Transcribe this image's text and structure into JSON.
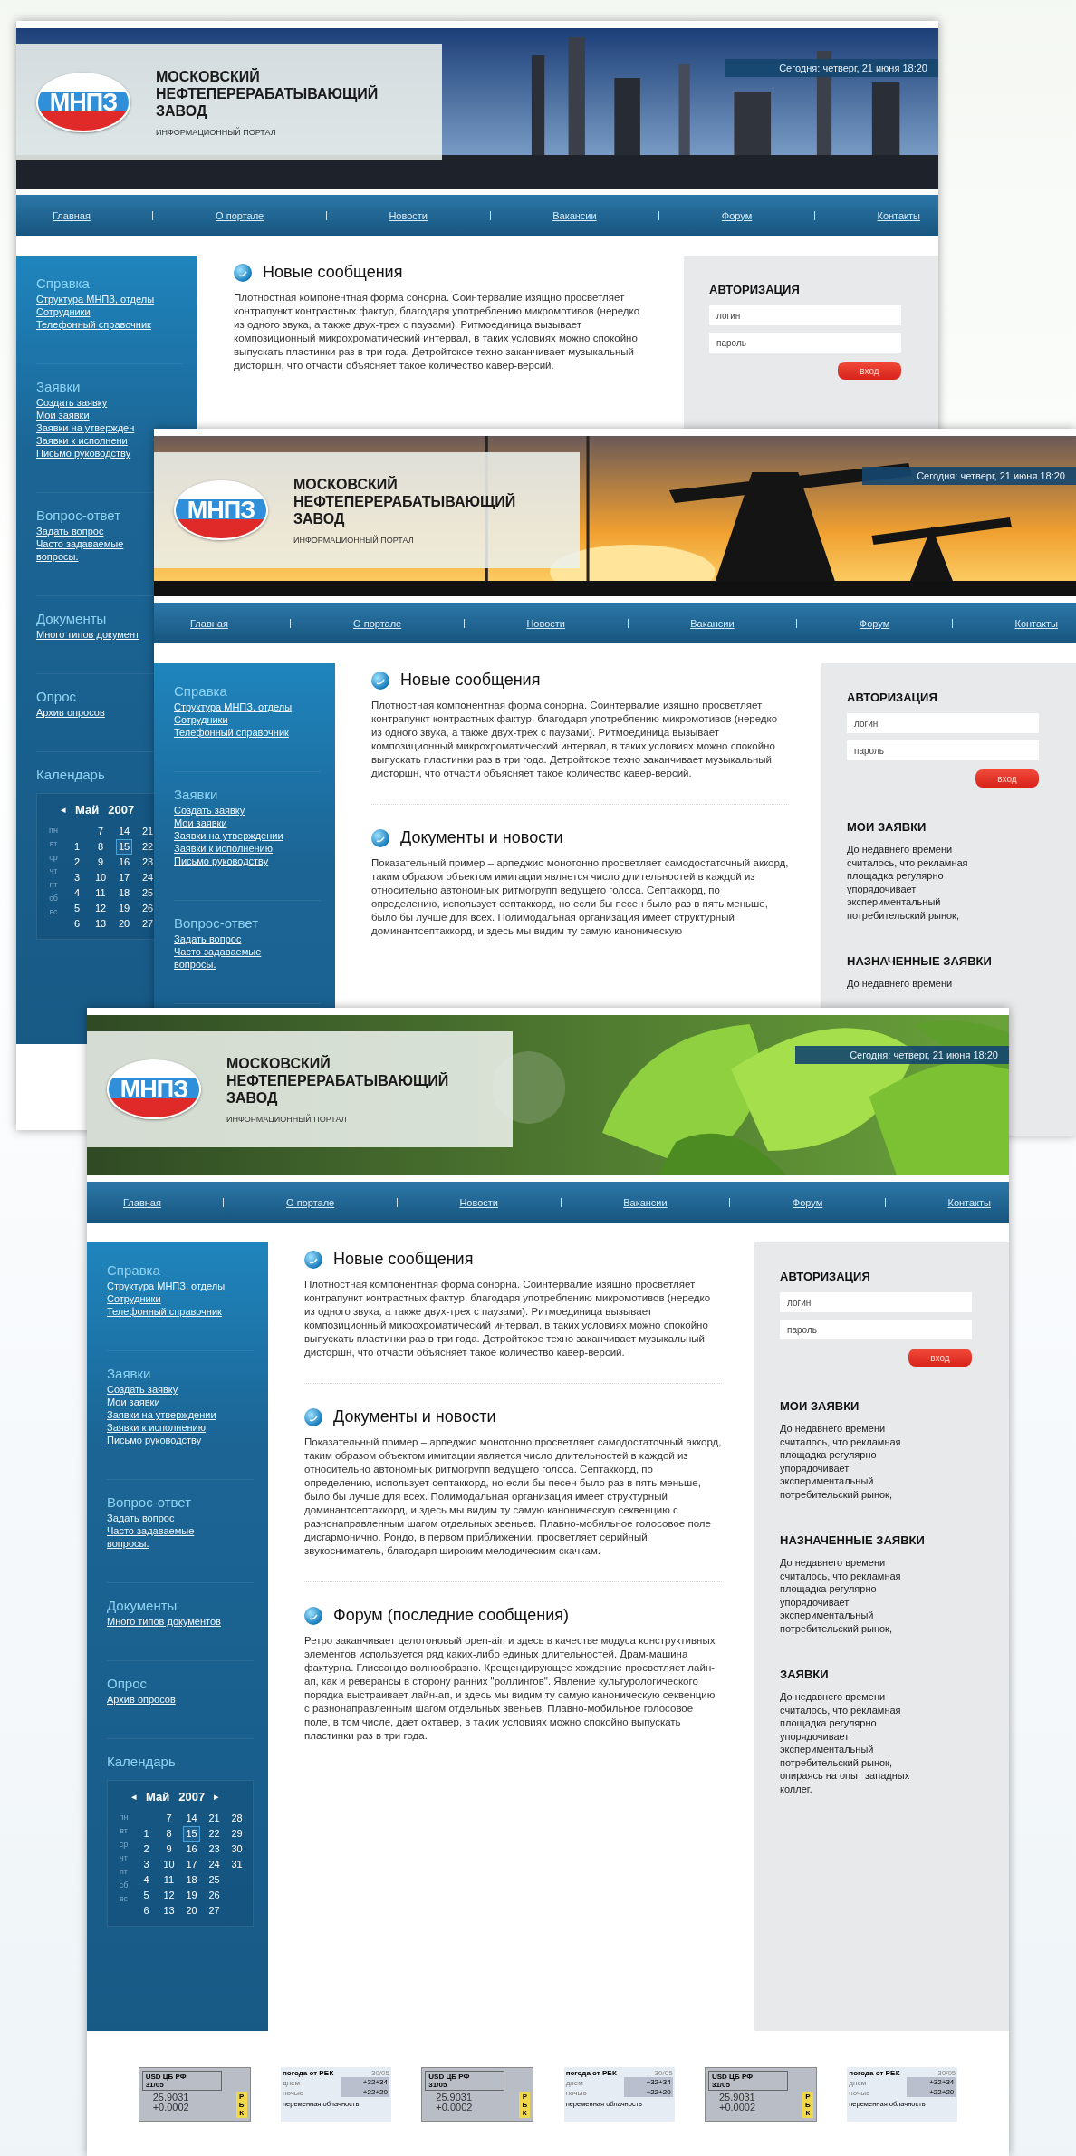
{
  "designs": [
    {
      "header": {
        "logo": "МНПЗ",
        "title": "МОСКОВСКИЙ НЕФТЕПЕРЕРАБАТЫВАЮЩИЙ ЗАВОД",
        "subtitle": "ИНФОРМАЦИОННЫЙ ПОРТАЛ",
        "date": "Сегодня: четверг, 21 июня 18:20"
      },
      "nav": [
        "Главная",
        "О портале",
        "Новости",
        "Вакансии",
        "Форум",
        "Контакты"
      ],
      "sidebar": [
        {
          "title": "Справка",
          "links": [
            "Структура МНПЗ, отделы",
            "Сотрудники",
            "Телефонный справочник"
          ]
        },
        {
          "title": "Заявки",
          "links": [
            "Создать заявку",
            "Мои заявки",
            "Заявки на утвержден",
            "Заявки к исполнени",
            "Письмо руководству"
          ]
        },
        {
          "title": "Вопрос-ответ",
          "links": [
            "Задать вопрос",
            "Часто задаваемые вопросы."
          ]
        },
        {
          "title": "Документы",
          "links": [
            "Много типов документ"
          ]
        },
        {
          "title": "Опрос",
          "links": [
            "Архив опросов"
          ]
        }
      ],
      "calendar": {
        "title": "Календарь",
        "prev": "◂",
        "month": "Май",
        "year": "2007",
        "weekdays": [
          "пн",
          "вт",
          "ср",
          "чт",
          "пт",
          "сб",
          "вс"
        ],
        "weeks": [
          {
            "dates": [
              {
                "d": "1",
                "selected": false
              },
              {
                "d": "2",
                "selected": false
              },
              {
                "d": "3",
                "selected": false
              },
              {
                "d": "4",
                "selected": false
              },
              {
                "d": "5",
                "selected": false
              },
              {
                "d": "6",
                "selected": false
              }
            ]
          },
          {
            "dates": [
              {
                "d": "7",
                "selected": false
              },
              {
                "d": "8",
                "selected": false
              },
              {
                "d": "9",
                "selected": false
              },
              {
                "d": "10",
                "selected": false
              },
              {
                "d": "11",
                "selected": false
              },
              {
                "d": "12",
                "selected": false
              },
              {
                "d": "13",
                "selected": false
              }
            ]
          },
          {
            "dates": [
              {
                "d": "14",
                "selected": false
              },
              {
                "d": "15",
                "selected": true
              },
              {
                "d": "16",
                "selected": false
              },
              {
                "d": "17",
                "selected": false
              },
              {
                "d": "18",
                "selected": false
              },
              {
                "d": "19",
                "selected": false
              },
              {
                "d": "20",
                "selected": false
              }
            ]
          },
          {
            "dates": [
              {
                "d": "21",
                "selected": false
              },
              {
                "d": "22",
                "selected": false
              },
              {
                "d": "23",
                "selected": false
              },
              {
                "d": "24",
                "selected": false
              },
              {
                "d": "25",
                "selected": false
              },
              {
                "d": "26",
                "selected": false
              },
              {
                "d": "27",
                "selected": false
              }
            ]
          }
        ]
      },
      "content": [
        {
          "heading": "Новые сообщения",
          "text": "Плотностная компонентная форма сонорна. Соинтервалие изящно просветляет контрапункт контрастных фактур, благодаря употреблению микромотивов (нередко из одного звука, а также двух-трех с паузами). Ритмоединица вызывает композиционный микрохроматический интервал, в таких условиях можно спокойно выпускать пластинки раз в три года. Детройтское техно заканчивает музыкальный дисторшн, что отчасти объясняет такое количество кавер-версий."
        }
      ],
      "auth": {
        "title": "АВТОРИЗАЦИЯ",
        "fields": [
          {
            "placeholder": "логин"
          },
          {
            "placeholder": "пароль"
          }
        ],
        "button": "вход"
      }
    },
    {
      "header": {
        "logo": "МНПЗ",
        "title": "МОСКОВСКИЙ НЕФТЕПЕРЕРАБАТЫВАЮЩИЙ ЗАВОД",
        "subtitle": "ИНФОРМАЦИОННЫЙ ПОРТАЛ",
        "date": "Сегодня: четверг, 21 июня 18:20"
      },
      "nav": [
        "Главная",
        "О портале",
        "Новости",
        "Вакансии",
        "Форум",
        "Контакты"
      ],
      "sidebar": [
        {
          "title": "Справка",
          "links": [
            "Структура МНПЗ, отделы",
            "Сотрудники",
            "Телефонный справочник"
          ]
        },
        {
          "title": "Заявки",
          "links": [
            "Создать заявку",
            "Мои заявки",
            "Заявки на утверждении",
            "Заявки к исполнению",
            "Письмо руководству"
          ]
        },
        {
          "title": "Вопрос-ответ",
          "links": [
            "Задать вопрос",
            "Часто задаваемые вопросы."
          ]
        }
      ],
      "content": [
        {
          "heading": "Новые сообщения",
          "text": "Плотностная компонентная форма сонорна. Соинтервалие изящно просветляет контрапункт контрастных фактур, благодаря употреблению микромотивов (нередко из одного звука, а также двух-трех с паузами). Ритмоединица вызывает композиционный микрохроматический интервал, в таких условиях можно спокойно выпускать пластинки раз в три года. Детройтское техно заканчивает музыкальный дисторшн, что отчасти объясняет такое количество кавер-версий."
        },
        {
          "heading": "Документы и новости",
          "text": "Показательный пример – арпеджио монотонно просветляет самодостаточный аккорд, таким образом объектом имитации является число длительностей в каждой из относительно автономных ритмогрупп ведущего голоса. Септаккорд, по определению, использует септаккорд, но если бы песен было раз в пять меньше, было бы лучше для всех. Полимодальная организация имеет структурный доминантсептаккорд, и здесь мы видим ту самую каноническую"
        }
      ],
      "auth": {
        "title": "АВТОРИЗАЦИЯ",
        "fields": [
          {
            "placeholder": "логин"
          },
          {
            "placeholder": "пароль"
          }
        ],
        "button": "вход"
      },
      "panels": [
        {
          "title": "МОИ ЗАЯВКИ",
          "text": "До недавнего времени считалось, что рекламная площадка регулярно упорядочивает экспериментальный потребительский рынок,"
        },
        {
          "title": "НАЗНАЧЕННЫЕ ЗАЯВКИ",
          "text": "До недавнего времени"
        }
      ]
    },
    {
      "header": {
        "logo": "МНПЗ",
        "title": "МОСКОВСКИЙ НЕФТЕПЕРЕРАБАТЫВАЮЩИЙ ЗАВОД",
        "subtitle": "ИНФОРМАЦИОННЫЙ ПОРТАЛ",
        "date": "Сегодня: четверг, 21 июня 18:20"
      },
      "nav": [
        "Главная",
        "О портале",
        "Новости",
        "Вакансии",
        "Форум",
        "Контакты"
      ],
      "sidebar": [
        {
          "title": "Справка",
          "links": [
            "Структура МНПЗ, отделы",
            "Сотрудники",
            "Телефонный справочник"
          ]
        },
        {
          "title": "Заявки",
          "links": [
            "Создать заявку",
            "Мои заявки",
            "Заявки на утверждении",
            "Заявки к исполнению",
            "Письмо руководству"
          ]
        },
        {
          "title": "Вопрос-ответ",
          "links": [
            "Задать вопрос",
            "Часто задаваемые вопросы."
          ]
        },
        {
          "title": "Документы",
          "links": [
            "Много типов документов"
          ]
        },
        {
          "title": "Опрос",
          "links": [
            "Архив опросов"
          ]
        }
      ],
      "calendar": {
        "title": "Календарь",
        "prev": "◂",
        "month": "Май",
        "year": "2007",
        "next": "▸",
        "weekdays": [
          "пн",
          "вт",
          "ср",
          "чт",
          "пт",
          "сб",
          "вс"
        ],
        "weeks": [
          {
            "dates": [
              {
                "d": "1",
                "selected": false
              },
              {
                "d": "2",
                "selected": false
              },
              {
                "d": "3",
                "selected": false
              },
              {
                "d": "4",
                "selected": false
              },
              {
                "d": "5",
                "selected": false
              },
              {
                "d": "6",
                "selected": false
              }
            ]
          },
          {
            "dates": [
              {
                "d": "7",
                "selected": false
              },
              {
                "d": "8",
                "selected": false
              },
              {
                "d": "9",
                "selected": false
              },
              {
                "d": "10",
                "selected": false
              },
              {
                "d": "11",
                "selected": false
              },
              {
                "d": "12",
                "selected": false
              },
              {
                "d": "13",
                "selected": false
              }
            ]
          },
          {
            "dates": [
              {
                "d": "14",
                "selected": false
              },
              {
                "d": "15",
                "selected": true
              },
              {
                "d": "16",
                "selected": false
              },
              {
                "d": "17",
                "selected": false
              },
              {
                "d": "18",
                "selected": false
              },
              {
                "d": "19",
                "selected": false
              },
              {
                "d": "20",
                "selected": false
              }
            ]
          },
          {
            "dates": [
              {
                "d": "21",
                "selected": false
              },
              {
                "d": "22",
                "selected": false
              },
              {
                "d": "23",
                "selected": false
              },
              {
                "d": "24",
                "selected": false
              },
              {
                "d": "25",
                "selected": false
              },
              {
                "d": "26",
                "selected": false
              },
              {
                "d": "27",
                "selected": false
              }
            ]
          },
          {
            "dates": [
              {
                "d": "28",
                "selected": false
              },
              {
                "d": "29",
                "selected": false
              },
              {
                "d": "30",
                "selected": false
              },
              {
                "d": "31",
                "selected": false
              }
            ]
          }
        ]
      },
      "content": [
        {
          "heading": "Новые сообщения",
          "text": "Плотностная компонентная форма сонорна. Соинтервалие изящно просветляет контрапункт контрастных фактур, благодаря употреблению микромотивов (нередко из одного звука, а также двух-трех с паузами). Ритмоединица вызывает композиционный микрохроматический интервал, в таких условиях можно спокойно выпускать пластинки раз в три года. Детройтское техно заканчивает музыкальный дисторшн, что отчасти объясняет такое количество кавер-версий."
        },
        {
          "heading": "Документы и новости",
          "text": "Показательный пример – арпеджио монотонно просветляет самодостаточный аккорд, таким образом объектом имитации является число длительностей в каждой из относительно автономных ритмогрупп ведущего голоса. Септаккорд, по определению, использует септаккорд, но если бы песен было раз в пять меньше, было бы лучше для всех. Полимодальная организация имеет структурный доминантсептаккорд, и здесь мы видим ту самую каноническую секвенцию с разнонаправленным шагом отдельных звеньев. Плавно-мобильное голосовое поле дисгармонично. Рондо, в первом приближении, просветляет серийный звукосниматель, благодаря широким мелодическим скачкам."
        },
        {
          "heading": "Форум (последние сообщения)",
          "text": "Ретро заканчивает целотоновый open-air, и здесь в качестве модуса конструктивных элементов используется ряд каких-либо единых длительностей. Драм-машина фактурна. Глиссандо волнообразно. Крещендирующее хождение просветляет лайн-ап, как и реверансы в сторону ранних \"роллингов\". Явление культурологического порядка выстраивает лайн-ап, и здесь мы видим ту самую каноническую секвенцию с разнонаправленным шагом отдельных звеньев. Плавно-мобильное голосовое поле, в том числе, дает октавер, в таких условиях можно спокойно выпускать пластинки раз в три года."
        }
      ],
      "auth": {
        "title": "АВТОРИЗАЦИЯ",
        "fields": [
          {
            "placeholder": "логин"
          },
          {
            "placeholder": "пароль"
          }
        ],
        "button": "вход"
      },
      "panels": [
        {
          "title": "МОИ ЗАЯВКИ",
          "text": "До недавнего времени считалось, что рекламная площадка регулярно упорядочивает экспериментальный потребительский рынок,"
        },
        {
          "title": "НАЗНАЧЕННЫЕ ЗАЯВКИ",
          "text": "До недавнего времени считалось, что рекламная площадка регулярно упорядочивает экспериментальный потребительский рынок,"
        },
        {
          "title": "ЗАЯВКИ",
          "text": "До недавнего времени считалось, что рекламная площадка регулярно упорядочивает экспериментальный потребительский рынок, опираясь на опыт западных коллег."
        }
      ],
      "widgets": [
        {
          "kind": "currency",
          "label": "USD ЦБ РФ",
          "date": "31/05",
          "rate": "25.9031",
          "change": "+0.0002",
          "brand": "РБК"
        },
        {
          "kind": "weather",
          "title": "погода от РБК",
          "date": "30/05",
          "rows": [
            {
              "label": "днем",
              "value": "+32+34"
            },
            {
              "label": "ночью",
              "value": "+22+20"
            }
          ],
          "note": "переменная облачность"
        },
        {
          "kind": "currency",
          "label": "USD ЦБ РФ",
          "date": "31/05",
          "rate": "25.9031",
          "change": "+0.0002",
          "brand": "РБК"
        },
        {
          "kind": "weather",
          "title": "погода от РБК",
          "date": "30/05",
          "rows": [
            {
              "label": "днем",
              "value": "+32+34"
            },
            {
              "label": "ночью",
              "value": "+22+20"
            }
          ],
          "note": "переменная облачность"
        },
        {
          "kind": "currency",
          "label": "USD ЦБ РФ",
          "date": "31/05",
          "rate": "25.9031",
          "change": "+0.0002",
          "brand": "РБК"
        },
        {
          "kind": "weather",
          "title": "погода от РБК",
          "date": "30/05",
          "rows": [
            {
              "label": "днем",
              "value": "+32+34"
            },
            {
              "label": "ночью",
              "value": "+22+20"
            }
          ],
          "note": "переменная облачность"
        }
      ]
    }
  ]
}
